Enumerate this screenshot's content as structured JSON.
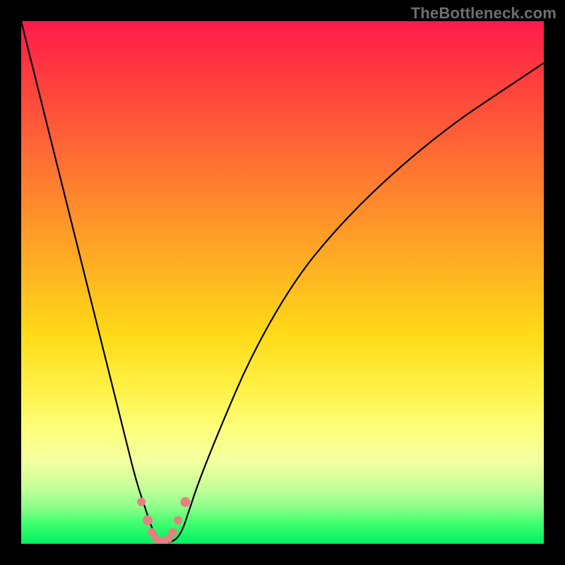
{
  "watermark": {
    "text": "TheBottleneck.com"
  },
  "chart_data": {
    "type": "line",
    "title": "",
    "xlabel": "",
    "ylabel": "",
    "xlim": [
      0,
      100
    ],
    "ylim": [
      0,
      100
    ],
    "grid": false,
    "legend": false,
    "series": [
      {
        "name": "curve",
        "x": [
          0,
          4,
          8,
          12,
          16,
          20,
          22,
          24,
          25,
          26,
          27,
          28,
          29,
          30,
          31,
          32,
          34,
          38,
          44,
          52,
          60,
          70,
          82,
          94,
          100
        ],
        "y": [
          100,
          84,
          68,
          52,
          36,
          20,
          12,
          6,
          3,
          1.2,
          0.5,
          0.2,
          0.5,
          1.2,
          3,
          6,
          12,
          22,
          36,
          50,
          60,
          70,
          80,
          88,
          92
        ]
      }
    ],
    "marker_cluster": {
      "name": "bottleneck-points",
      "color": "#e58082",
      "points": [
        {
          "x": 23.0,
          "y": 8.0,
          "r": 6
        },
        {
          "x": 24.2,
          "y": 4.5,
          "r": 7
        },
        {
          "x": 25.0,
          "y": 2.2,
          "r": 6
        },
        {
          "x": 25.8,
          "y": 1.0,
          "r": 6
        },
        {
          "x": 26.6,
          "y": 0.5,
          "r": 6
        },
        {
          "x": 27.4,
          "y": 0.5,
          "r": 6
        },
        {
          "x": 28.2,
          "y": 1.0,
          "r": 6
        },
        {
          "x": 29.0,
          "y": 2.2,
          "r": 6
        },
        {
          "x": 30.0,
          "y": 4.5,
          "r": 6
        },
        {
          "x": 31.4,
          "y": 8.0,
          "r": 7
        }
      ]
    },
    "colors": {
      "curve": "#000000",
      "marker": "#e58082"
    }
  }
}
